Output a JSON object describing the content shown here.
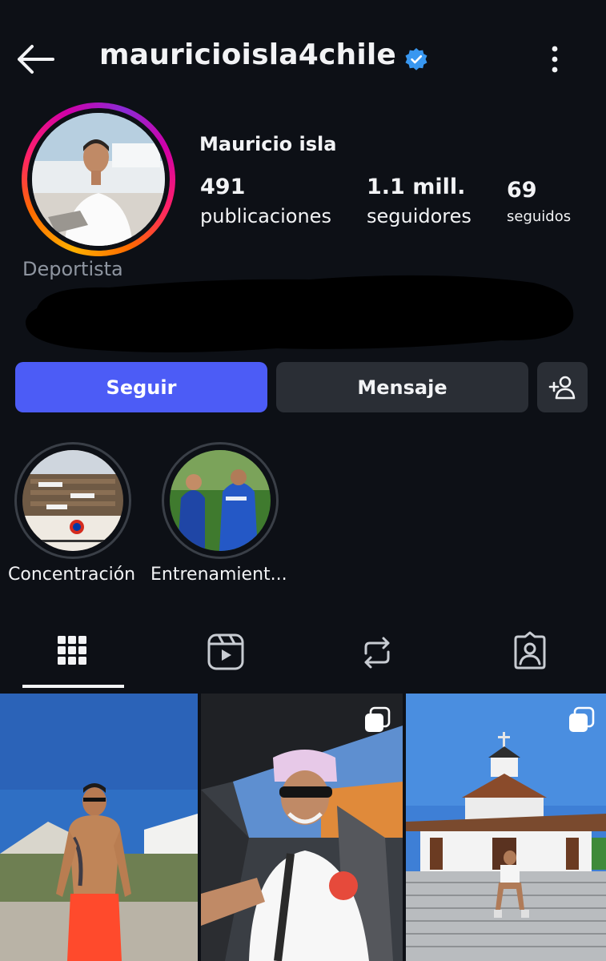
{
  "header": {
    "username": "mauricioisla4chile",
    "back_icon": "back-arrow-icon",
    "verified_icon": "verified-badge-icon",
    "more_icon": "more-vertical-icon",
    "verified_color": "#3897f0"
  },
  "profile": {
    "display_name": "Mauricio isla",
    "category": "Deportista",
    "stats": {
      "posts": {
        "value": "491",
        "label": "publicaciones"
      },
      "followers": {
        "value": "1.1 mill.",
        "label": "seguidores"
      },
      "following": {
        "value": "69",
        "label": "seguidos"
      }
    }
  },
  "actions": {
    "follow_label": "Seguir",
    "message_label": "Mensaje",
    "suggest_icon": "add-person-icon",
    "follow_color": "#4c5cf6"
  },
  "highlights": [
    {
      "label": "Concentración"
    },
    {
      "label": "Entrenamient..."
    }
  ],
  "tabs": [
    {
      "icon": "grid-icon",
      "active": true
    },
    {
      "icon": "reels-icon",
      "active": false
    },
    {
      "icon": "reposts-icon",
      "active": false
    },
    {
      "icon": "tagged-icon",
      "active": false
    }
  ],
  "posts": [
    {
      "multi": false
    },
    {
      "multi": true,
      "icon": "carousel-icon"
    },
    {
      "multi": true,
      "icon": "carousel-icon"
    }
  ]
}
